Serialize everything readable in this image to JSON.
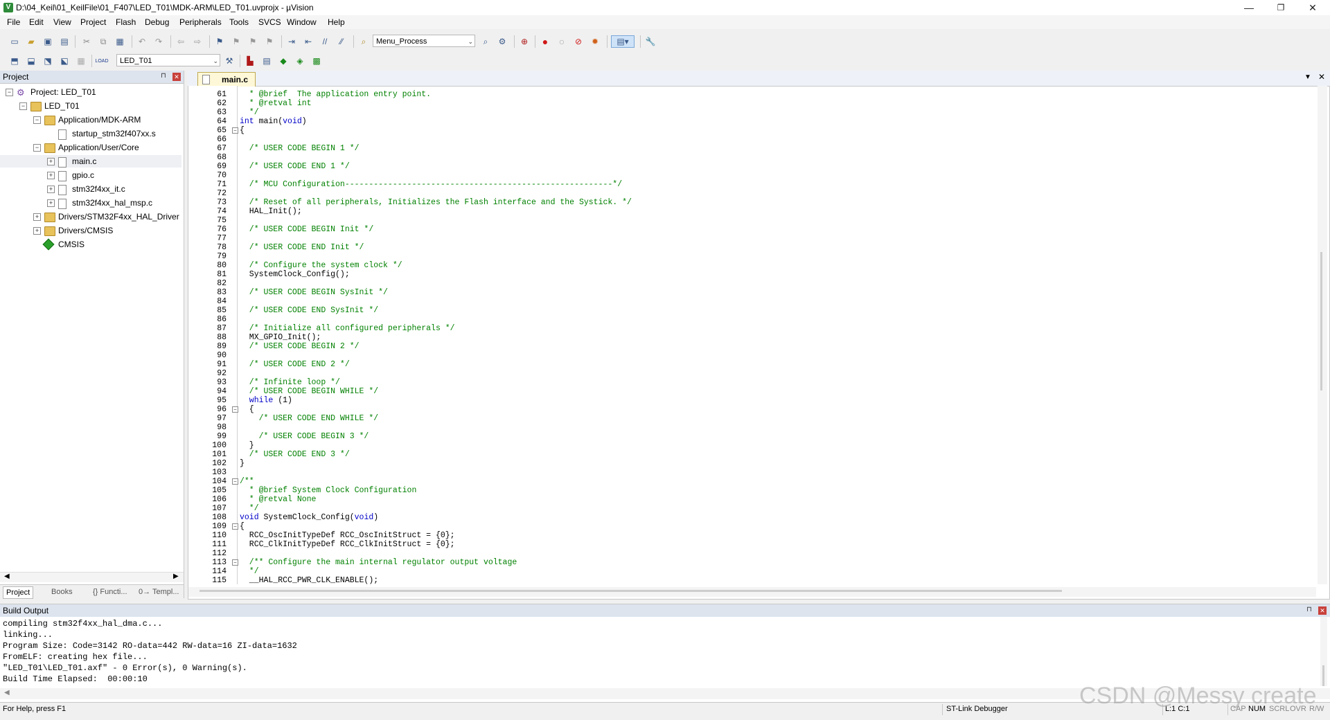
{
  "window": {
    "title": "D:\\04_Keil\\01_KeilFile\\01_F407\\LED_T01\\MDK-ARM\\LED_T01.uvprojx - µVision",
    "app_icon": "V",
    "minimize_glyph": "—",
    "maximize_glyph": "❐",
    "close_glyph": "✕"
  },
  "menu": [
    "File",
    "Edit",
    "View",
    "Project",
    "Flash",
    "Debug",
    "Peripherals",
    "Tools",
    "SVCS",
    "Window",
    "Help"
  ],
  "toolbar1": {
    "function_combo": "Menu_Process"
  },
  "toolbar2": {
    "target_combo": "LED_T01",
    "load_label": "LOAD"
  },
  "project_panel": {
    "title": "Project",
    "pin_glyph": "⊓",
    "close_glyph": "✕",
    "tree": [
      {
        "label": "Project: LED_T01",
        "indent": 0,
        "icon": "project-icon",
        "expander": "−"
      },
      {
        "label": "LED_T01",
        "indent": 1,
        "icon": "folder-icon",
        "expander": "−"
      },
      {
        "label": "Application/MDK-ARM",
        "indent": 2,
        "icon": "folder-icon",
        "expander": "−"
      },
      {
        "label": "startup_stm32f407xx.s",
        "indent": 3,
        "icon": "file-icon",
        "expander": ""
      },
      {
        "label": "Application/User/Core",
        "indent": 2,
        "icon": "folder-icon",
        "expander": "−"
      },
      {
        "label": "main.c",
        "indent": 3,
        "icon": "file-icon",
        "expander": "+"
      },
      {
        "label": "gpio.c",
        "indent": 3,
        "icon": "file-icon",
        "expander": "+"
      },
      {
        "label": "stm32f4xx_it.c",
        "indent": 3,
        "icon": "file-icon",
        "expander": "+"
      },
      {
        "label": "stm32f4xx_hal_msp.c",
        "indent": 3,
        "icon": "file-icon",
        "expander": "+"
      },
      {
        "label": "Drivers/STM32F4xx_HAL_Driver",
        "indent": 2,
        "icon": "folder-icon",
        "expander": "+"
      },
      {
        "label": "Drivers/CMSIS",
        "indent": 2,
        "icon": "folder-icon",
        "expander": "+"
      },
      {
        "label": "CMSIS",
        "indent": 2,
        "icon": "cmsis-diamond-icon",
        "expander": ""
      }
    ],
    "tabs": [
      "Project",
      "Books",
      "{} Functi...",
      "0→ Templ..."
    ]
  },
  "editor": {
    "tab_label": "main.c",
    "lines": [
      {
        "n": "61",
        "parts": [
          [
            "cm",
            "  * @brief  The application entry point."
          ]
        ]
      },
      {
        "n": "62",
        "parts": [
          [
            "cm",
            "  * @retval int"
          ]
        ]
      },
      {
        "n": "63",
        "parts": [
          [
            "cm",
            "  */"
          ]
        ]
      },
      {
        "n": "64",
        "parts": [
          [
            "kw",
            "int"
          ],
          [
            "tx",
            " main("
          ],
          [
            "kw",
            "void"
          ],
          [
            "tx",
            ")"
          ]
        ]
      },
      {
        "n": "65",
        "fold": "−",
        "parts": [
          [
            "tx",
            "{"
          ]
        ]
      },
      {
        "n": "66",
        "parts": []
      },
      {
        "n": "67",
        "parts": [
          [
            "cm",
            "  /* USER CODE BEGIN 1 */"
          ]
        ]
      },
      {
        "n": "68",
        "parts": []
      },
      {
        "n": "69",
        "parts": [
          [
            "cm",
            "  /* USER CODE END 1 */"
          ]
        ]
      },
      {
        "n": "70",
        "parts": []
      },
      {
        "n": "71",
        "parts": [
          [
            "cm",
            "  /* MCU Configuration--------------------------------------------------------*/"
          ]
        ]
      },
      {
        "n": "72",
        "parts": []
      },
      {
        "n": "73",
        "parts": [
          [
            "cm",
            "  /* Reset of all peripherals, Initializes the Flash interface and the Systick. */"
          ]
        ]
      },
      {
        "n": "74",
        "parts": [
          [
            "tx",
            "  HAL_Init();"
          ]
        ]
      },
      {
        "n": "75",
        "parts": []
      },
      {
        "n": "76",
        "parts": [
          [
            "cm",
            "  /* USER CODE BEGIN Init */"
          ]
        ]
      },
      {
        "n": "77",
        "parts": []
      },
      {
        "n": "78",
        "parts": [
          [
            "cm",
            "  /* USER CODE END Init */"
          ]
        ]
      },
      {
        "n": "79",
        "parts": []
      },
      {
        "n": "80",
        "parts": [
          [
            "cm",
            "  /* Configure the system clock */"
          ]
        ]
      },
      {
        "n": "81",
        "parts": [
          [
            "tx",
            "  SystemClock_Config();"
          ]
        ]
      },
      {
        "n": "82",
        "parts": []
      },
      {
        "n": "83",
        "parts": [
          [
            "cm",
            "  /* USER CODE BEGIN SysInit */"
          ]
        ]
      },
      {
        "n": "84",
        "parts": []
      },
      {
        "n": "85",
        "parts": [
          [
            "cm",
            "  /* USER CODE END SysInit */"
          ]
        ]
      },
      {
        "n": "86",
        "parts": []
      },
      {
        "n": "87",
        "parts": [
          [
            "cm",
            "  /* Initialize all configured peripherals */"
          ]
        ]
      },
      {
        "n": "88",
        "parts": [
          [
            "tx",
            "  MX_GPIO_Init();"
          ]
        ]
      },
      {
        "n": "89",
        "parts": [
          [
            "cm",
            "  /* USER CODE BEGIN 2 */"
          ]
        ]
      },
      {
        "n": "90",
        "parts": []
      },
      {
        "n": "91",
        "parts": [
          [
            "cm",
            "  /* USER CODE END 2 */"
          ]
        ]
      },
      {
        "n": "92",
        "parts": []
      },
      {
        "n": "93",
        "parts": [
          [
            "cm",
            "  /* Infinite loop */"
          ]
        ]
      },
      {
        "n": "94",
        "parts": [
          [
            "cm",
            "  /* USER CODE BEGIN WHILE */"
          ]
        ]
      },
      {
        "n": "95",
        "parts": [
          [
            "kw",
            "  while"
          ],
          [
            "tx",
            " (1)"
          ]
        ]
      },
      {
        "n": "96",
        "fold": "−",
        "parts": [
          [
            "tx",
            "  {"
          ]
        ]
      },
      {
        "n": "97",
        "parts": [
          [
            "cm",
            "    /* USER CODE END WHILE */"
          ]
        ]
      },
      {
        "n": "98",
        "parts": []
      },
      {
        "n": "99",
        "parts": [
          [
            "cm",
            "    /* USER CODE BEGIN 3 */"
          ]
        ]
      },
      {
        "n": "100",
        "parts": [
          [
            "tx",
            "  }"
          ]
        ]
      },
      {
        "n": "101",
        "parts": [
          [
            "cm",
            "  /* USER CODE END 3 */"
          ]
        ]
      },
      {
        "n": "102",
        "parts": [
          [
            "tx",
            "}"
          ]
        ]
      },
      {
        "n": "103",
        "parts": []
      },
      {
        "n": "104",
        "fold": "−",
        "parts": [
          [
            "cm",
            "/**"
          ]
        ]
      },
      {
        "n": "105",
        "parts": [
          [
            "cm",
            "  * @brief System Clock Configuration"
          ]
        ]
      },
      {
        "n": "106",
        "parts": [
          [
            "cm",
            "  * @retval None"
          ]
        ]
      },
      {
        "n": "107",
        "parts": [
          [
            "cm",
            "  */"
          ]
        ]
      },
      {
        "n": "108",
        "parts": [
          [
            "kw",
            "void"
          ],
          [
            "tx",
            " SystemClock_Config("
          ],
          [
            "kw",
            "void"
          ],
          [
            "tx",
            ")"
          ]
        ]
      },
      {
        "n": "109",
        "fold": "−",
        "parts": [
          [
            "tx",
            "{"
          ]
        ]
      },
      {
        "n": "110",
        "parts": [
          [
            "tx",
            "  RCC_OscInitTypeDef RCC_OscInitStruct = {0};"
          ]
        ]
      },
      {
        "n": "111",
        "parts": [
          [
            "tx",
            "  RCC_ClkInitTypeDef RCC_ClkInitStruct = {0};"
          ]
        ]
      },
      {
        "n": "112",
        "parts": []
      },
      {
        "n": "113",
        "fold": "−",
        "parts": [
          [
            "cm",
            "  /** Configure the main internal regulator output voltage"
          ]
        ]
      },
      {
        "n": "114",
        "parts": [
          [
            "cm",
            "  */"
          ]
        ]
      },
      {
        "n": "115",
        "parts": [
          [
            "tx",
            "  __HAL_RCC_PWR_CLK_ENABLE();"
          ]
        ]
      }
    ]
  },
  "build_output": {
    "title": "Build Output",
    "lines": [
      "compiling stm32f4xx_hal_dma.c...",
      "linking...",
      "Program Size: Code=3142 RO-data=442 RW-data=16 ZI-data=1632",
      "FromELF: creating hex file...",
      "\"LED_T01\\LED_T01.axf\" - 0 Error(s), 0 Warning(s).",
      "Build Time Elapsed:  00:00:10"
    ]
  },
  "status": {
    "help": "For Help, press F1",
    "debugger": "ST-Link Debugger",
    "cursor": "L:1 C:1",
    "caps": "CAP",
    "num": "NUM",
    "scrl": "SCRL",
    "ovr": "OVR",
    "rw": "R/W"
  },
  "watermark": "CSDN @Messy create",
  "colors": {
    "keyword": "#0000c8",
    "comment": "#008000",
    "tab_active": "#fff8d8"
  }
}
